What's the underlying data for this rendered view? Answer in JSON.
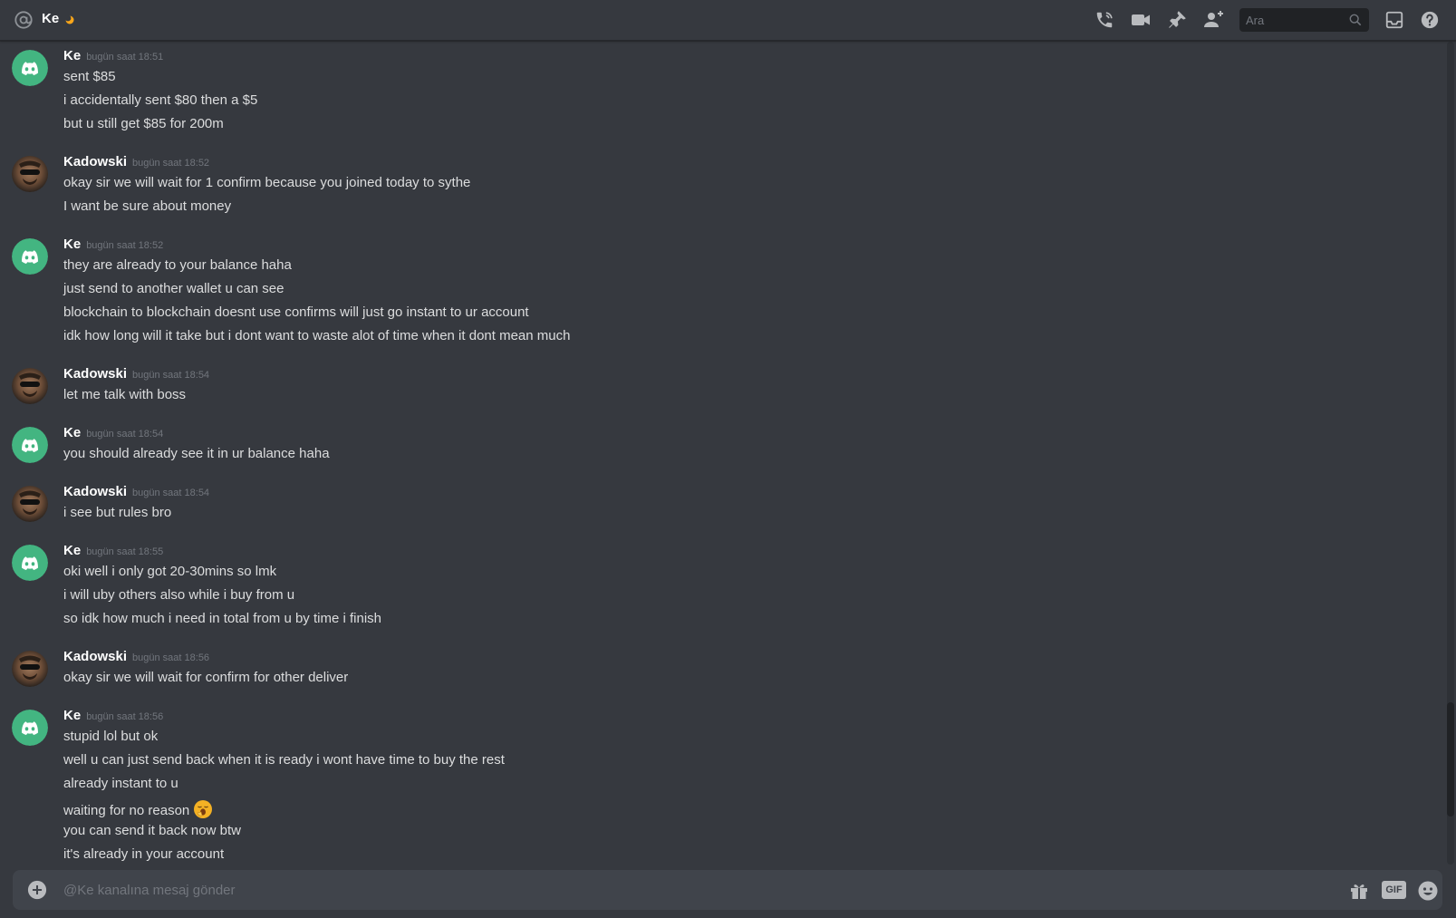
{
  "header": {
    "title": "Ke",
    "search_placeholder": "Ara"
  },
  "icons": {
    "header": [
      "at-icon",
      "idle-moon-icon",
      "call-icon",
      "video-call-icon",
      "pin-icon",
      "add-friend-icon",
      "search-icon",
      "inbox-icon",
      "help-icon"
    ],
    "composer": [
      "add-attachment-icon",
      "gift-icon",
      "gif-icon",
      "emoji-icon"
    ]
  },
  "colors": {
    "background": "#36393f",
    "discord_avatar_green": "#43b581",
    "header_text": "#ffffff",
    "muted": "#72767d",
    "idle_moon": "#faa61a"
  },
  "messages": [
    {
      "author": "Ke",
      "timestamp": "bugün saat 18:51",
      "lines": [
        "sent $85",
        "i accidentally sent $80 then a $5",
        "but u still get $85 for 200m"
      ]
    },
    {
      "author": "Kadowski",
      "timestamp": "bugün saat 18:52",
      "lines": [
        "okay sir we will wait for 1 confirm because you joined today to sythe",
        "I want be sure about money"
      ]
    },
    {
      "author": "Ke",
      "timestamp": "bugün saat 18:52",
      "lines": [
        "they are already to your balance haha",
        "just send to another wallet u can see",
        "blockchain to blockchain doesnt use confirms will just go instant to ur account",
        "idk how long will it take but i dont want to waste alot of time when it dont mean much"
      ]
    },
    {
      "author": "Kadowski",
      "timestamp": "bugün saat 18:54",
      "lines": [
        "let me talk with boss"
      ]
    },
    {
      "author": "Ke",
      "timestamp": "bugün saat 18:54",
      "lines": [
        "you should already see it in ur balance haha"
      ]
    },
    {
      "author": "Kadowski",
      "timestamp": "bugün saat 18:54",
      "lines": [
        "i see but rules bro"
      ]
    },
    {
      "author": "Ke",
      "timestamp": "bugün saat 18:55",
      "lines": [
        "oki well i only got 20-30mins so lmk",
        "i will uby others also while i buy from u",
        "so idk how much i need in total from u by time i finish"
      ]
    },
    {
      "author": "Kadowski",
      "timestamp": "bugün saat 18:56",
      "lines": [
        "okay sir we will wait for confirm for other deliver"
      ]
    },
    {
      "author": "Ke",
      "timestamp": "bugün saat 18:56",
      "lines": [
        "stupid lol but ok",
        "well u can just send back when it is ready i wont have time to buy the rest",
        "already instant to u",
        "waiting for no reason",
        "you can send it back now btw",
        "it's already in your account"
      ]
    }
  ],
  "composer": {
    "placeholder": "@Ke kanalına mesaj gönder",
    "gif_label": "GIF"
  }
}
